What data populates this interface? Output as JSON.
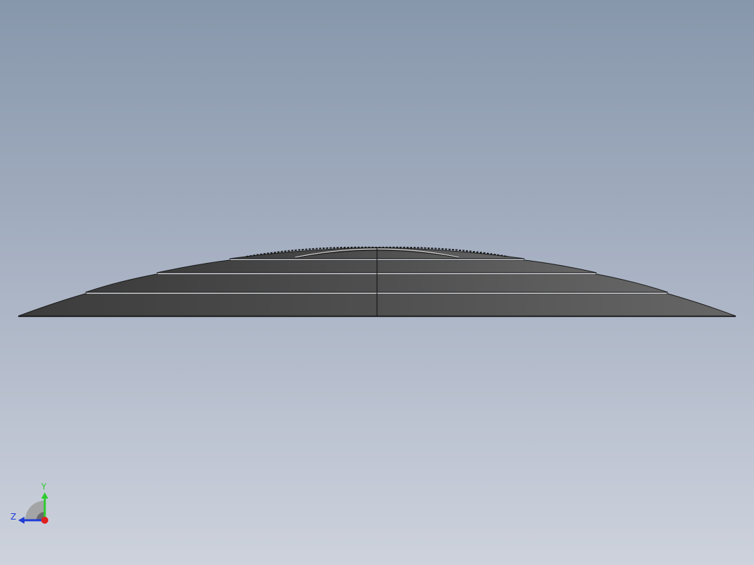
{
  "viewport": {
    "background_top": "#8797ab",
    "background_bottom": "#cdd2dc"
  },
  "model": {
    "description_icon": "dome-part-side-view",
    "face_color": "#505050",
    "edge_color": "#1a1a1a",
    "highlight_color": "#d8d8d8"
  },
  "triad": {
    "y_label": "Y",
    "z_label": "Z",
    "y_color": "#2ecc2e",
    "z_color": "#1f3bd6",
    "x_color": "#e02020"
  }
}
